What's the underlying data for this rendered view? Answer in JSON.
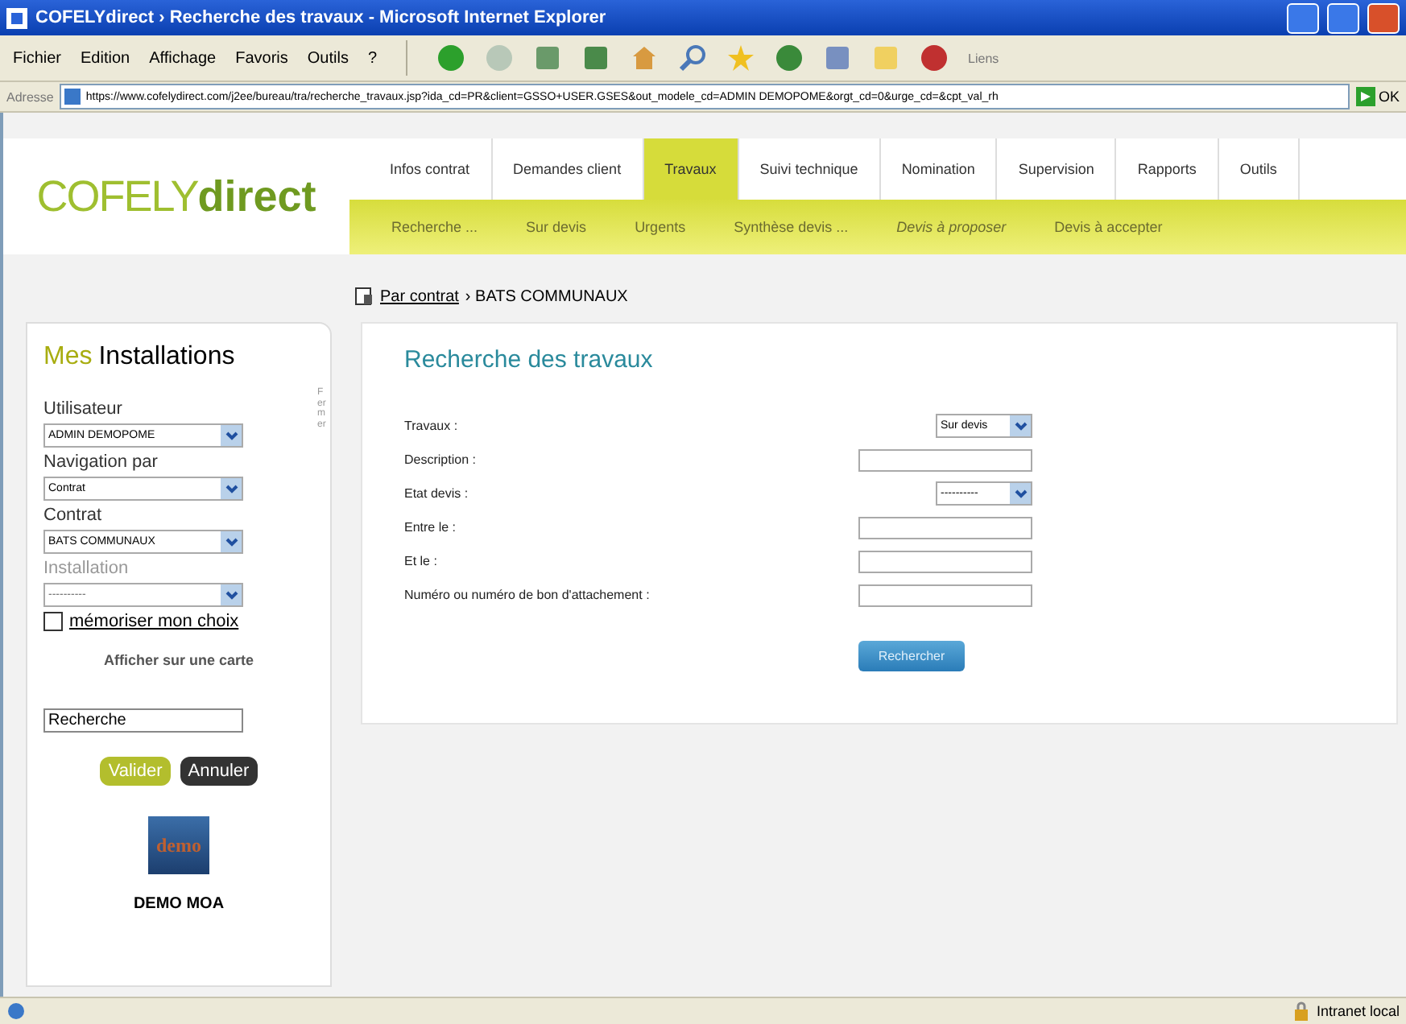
{
  "window": {
    "title": "COFELYdirect › Recherche des travaux - Microsoft Internet Explorer"
  },
  "menu": [
    "Fichier",
    "Edition",
    "Affichage",
    "Favoris",
    "Outils",
    "?"
  ],
  "toolbar": {
    "links_label": "Liens"
  },
  "address_bar": {
    "label": "Adresse",
    "url": "https://www.cofelydirect.com/j2ee/bureau/tra/recherche_travaux.jsp?ida_cd=PR&client=GSSO+USER.GSES&out_modele_cd=ADMIN DEMOPOME&orgt_cd=0&urge_cd=&cpt_val_rh",
    "go": "OK"
  },
  "logo": {
    "part_1": "COFELY",
    "part_2": "direct"
  },
  "tabs": [
    {
      "label": "Infos contrat",
      "selected": false
    },
    {
      "label": "Demandes client",
      "selected": false
    },
    {
      "label": "Travaux",
      "selected": true
    },
    {
      "label": "Suivi technique",
      "selected": false
    },
    {
      "label": "Nomination",
      "selected": false
    },
    {
      "label": "Supervision",
      "selected": false
    },
    {
      "label": "Rapports",
      "selected": false
    },
    {
      "label": "Outils",
      "selected": false
    }
  ],
  "subtabs": [
    {
      "label": "Recherche ...",
      "italic": false
    },
    {
      "label": "Sur devis",
      "italic": false
    },
    {
      "label": "Urgents",
      "italic": false
    },
    {
      "label": "Synthèse devis ...",
      "italic": false
    },
    {
      "label": "Devis à proposer",
      "italic": true
    },
    {
      "label": "Devis à accepter",
      "italic": false
    }
  ],
  "breadcrumb": {
    "link": "Par contrat",
    "current": "› BATS COMMUNAUX"
  },
  "sidebar": {
    "title_1": "Mes",
    "title_2": "Installations",
    "side_tab": "Fermer",
    "selects": [
      {
        "label": "Utilisateur",
        "value": "ADMIN DEMOPOME",
        "disabled": false
      },
      {
        "label": "Navigation par",
        "value": "Contrat",
        "disabled": false
      },
      {
        "label": "Contrat",
        "value": "BATS COMMUNAUX",
        "disabled": false
      },
      {
        "label": "Installation",
        "value": "----------",
        "disabled": true
      }
    ],
    "remember": {
      "label": "mémoriser mon choix",
      "checked": false
    },
    "map_link": "Afficher sur une carte",
    "search": {
      "value": "Recherche"
    },
    "buttons": [
      {
        "label": "Valider",
        "kind": "primary"
      },
      {
        "label": "Annuler",
        "kind": "dark"
      }
    ],
    "demo": {
      "badge": "demo",
      "caption": "DEMO MOA"
    }
  },
  "form": {
    "title": "Recherche des travaux",
    "fields": [
      {
        "label": "Travaux :",
        "kind": "select",
        "value": "Sur devis"
      },
      {
        "label": "Description :",
        "kind": "text"
      },
      {
        "label": "Etat devis :",
        "kind": "select",
        "value": "----------"
      },
      {
        "label": "Entre le :",
        "kind": "text"
      },
      {
        "label": "Et le :",
        "kind": "text"
      },
      {
        "label": "Numéro ou numéro de bon d'attachement :",
        "kind": "text"
      }
    ],
    "submit": "Rechercher"
  },
  "status_bar": {
    "zone": "Intranet local"
  }
}
